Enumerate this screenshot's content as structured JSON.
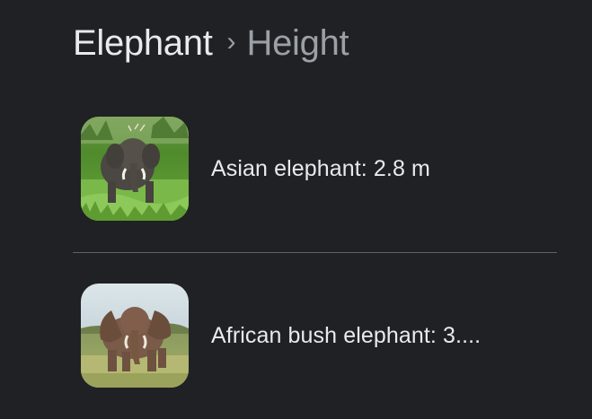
{
  "breadcrumb": {
    "root": "Elephant",
    "separator": "›",
    "current": "Height"
  },
  "items": [
    {
      "label": "Asian elephant: 2.8 m",
      "image": "asian-elephant-photo"
    },
    {
      "label": "African bush elephant: 3....",
      "image": "african-bush-elephant-photo"
    }
  ],
  "colors": {
    "background": "#202124",
    "text_primary": "#e8eaed",
    "text_secondary": "#9aa0a6",
    "divider": "#5f6368"
  }
}
